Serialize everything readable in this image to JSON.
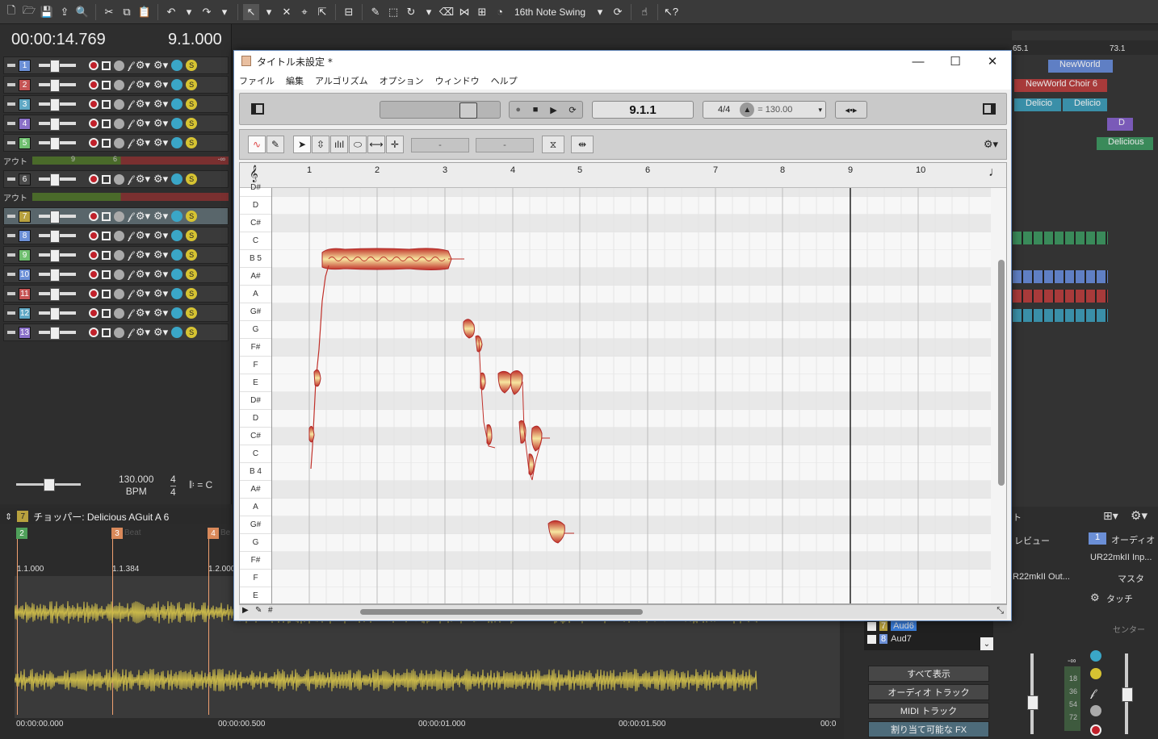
{
  "toolbar": {
    "swing_label": "16th Note Swing"
  },
  "transport": {
    "time": "00:00:14.769",
    "position": "9.1.000",
    "bpm_value": "130.000",
    "bpm_label": "BPM",
    "sig_top": "4",
    "sig_bottom": "4",
    "key": "= C"
  },
  "tracks": [
    {
      "num": "1",
      "color": "#6b8fd6"
    },
    {
      "num": "2",
      "color": "#c55454"
    },
    {
      "num": "3",
      "color": "#5fa8c4"
    },
    {
      "num": "4",
      "color": "#8a70c8"
    },
    {
      "num": "5",
      "color": "#6fbf6f"
    },
    {
      "num": "6",
      "color": "#4a4a4a"
    },
    {
      "num": "7",
      "color": "#b8a13e"
    },
    {
      "num": "8",
      "color": "#6b8fd6"
    },
    {
      "num": "9",
      "color": "#6fbf6f"
    },
    {
      "num": "10",
      "color": "#6b8fd6"
    },
    {
      "num": "11",
      "color": "#c55454"
    },
    {
      "num": "12",
      "color": "#5fa8c4"
    },
    {
      "num": "13",
      "color": "#8a70c8"
    }
  ],
  "out_label": "アウト",
  "out_meter_text": [
    "9",
    "6",
    "-∞"
  ],
  "arranger": {
    "ruler": [
      "65.1",
      "73.1"
    ],
    "clips": [
      {
        "label": "NewWorld",
        "color": "#5f7fc4"
      },
      {
        "label": "NewWorld Choir 6",
        "color": "#a83a3a"
      },
      {
        "label": "Delicio",
        "color": "#3a8fa8"
      },
      {
        "label": "Delicio",
        "color": "#3a8fa8"
      },
      {
        "label": "D",
        "color": "#7a5ab8"
      },
      {
        "label": "Delicious",
        "color": "#3a8a5a"
      }
    ]
  },
  "chopper": {
    "track_num": "7",
    "title": "チョッパー: Delicious AGuit A 6",
    "markers": [
      {
        "num": "2",
        "label": "",
        "pos": "1.1.000",
        "color": "#4fa05a"
      },
      {
        "num": "3",
        "label": "Beat",
        "pos": "1.1.384",
        "color": "#d9895a"
      },
      {
        "num": "4",
        "label": "Be",
        "pos": "1.2.000",
        "color": "#d9895a"
      }
    ],
    "time_ticks": [
      "00:00:00.000",
      "00:00:00.500",
      "00:00:01.000",
      "00:00:01.500",
      "00:0"
    ]
  },
  "console": {
    "tab_label": "ト",
    "preview_label": "レビュー",
    "channel_num": "1",
    "channel_type": "オーディオ",
    "input": "UR22mkII Inp...",
    "output": "R22mkII Out...",
    "master": "マスタ",
    "touch": "タッチ",
    "center": "センター",
    "minus_inf": "-∞",
    "meter_ticks": [
      "18",
      "36",
      "54",
      "72"
    ],
    "list_items": [
      {
        "num": "7",
        "label": "Aud6"
      },
      {
        "num": "8",
        "label": "Aud7"
      }
    ],
    "buttons": [
      "すべて表示",
      "オーディオ トラック",
      "MIDI トラック",
      "割り当て可能な FX"
    ]
  },
  "melodyne": {
    "title": "タイトル未設定 *",
    "menu": [
      "ファイル",
      "編集",
      "アルゴリズム",
      "オプション",
      "ウィンドウ",
      "ヘルプ"
    ],
    "position": "9.1.1",
    "time_sig": "4/4",
    "tempo": "= 130.00",
    "field_a": "-",
    "field_b": "-",
    "bars": [
      "1",
      "2",
      "3",
      "4",
      "5",
      "6",
      "7",
      "8",
      "9",
      "10"
    ],
    "keys": [
      "D#",
      "D",
      "C#",
      "C",
      "B 5",
      "A#",
      "A",
      "G#",
      "G",
      "F#",
      "F",
      "E",
      "D#",
      "D",
      "C#",
      "C",
      "B 4",
      "A#",
      "A",
      "G#",
      "G",
      "F#",
      "F",
      "E"
    ],
    "playhead_bar": 9
  }
}
